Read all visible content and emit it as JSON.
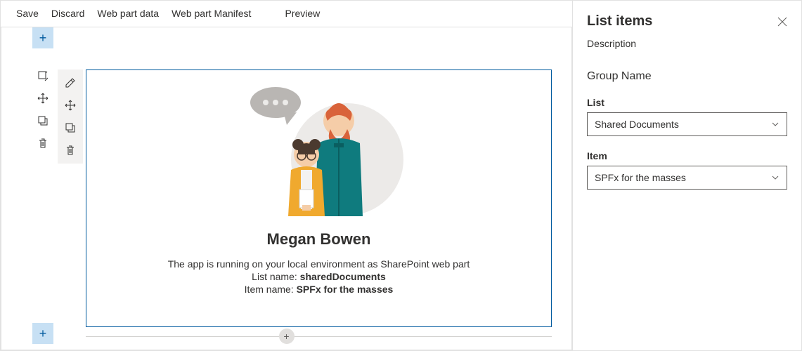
{
  "toolbar": {
    "save": "Save",
    "discard": "Discard",
    "wpdata": "Web part data",
    "wpman": "Web part Manifest",
    "preview": "Preview"
  },
  "card": {
    "name": "Megan Bowen",
    "env": "The app is running on your local environment as SharePoint web part",
    "listLabel": "List name: ",
    "listValue": "sharedDocuments",
    "itemLabel": "Item name: ",
    "itemValue": "SPFx for the masses"
  },
  "panel": {
    "title": "List items",
    "desc": "Description",
    "group": "Group Name",
    "listLbl": "List",
    "listSel": "Shared Documents",
    "itemLbl": "Item",
    "itemSel": "SPFx for the masses"
  }
}
